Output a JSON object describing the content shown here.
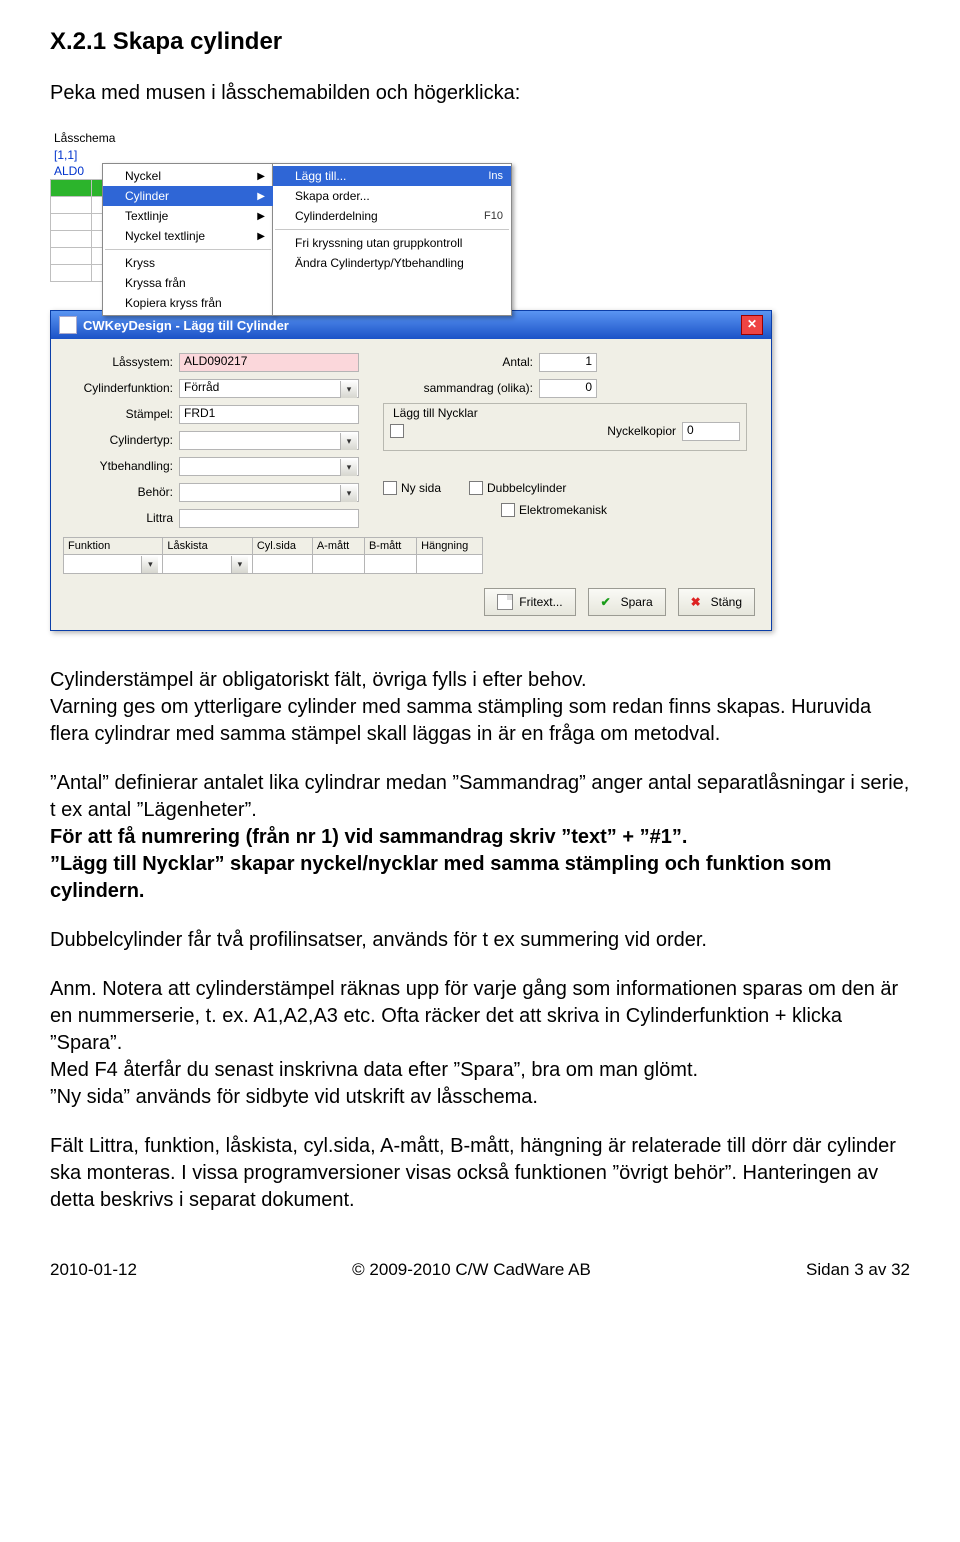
{
  "heading": "X.2.1 Skapa cylinder",
  "intro": "Peka med musen i låsschemabilden och högerklicka:",
  "scr1": {
    "title": "Låsschema",
    "coord": "[1,1]",
    "code": "ALD0",
    "menu1": {
      "items": [
        "Nyckel",
        "Cylinder",
        "Textlinje",
        "Nyckel textlinje"
      ],
      "items2": [
        "Kryss",
        "Kryssa från",
        "Kopiera kryss från"
      ]
    },
    "menu2": {
      "rows": [
        {
          "label": "Lägg till...",
          "short": "Ins",
          "sel": true
        },
        {
          "label": "Skapa order...",
          "short": ""
        },
        {
          "label": "Cylinderdelning",
          "short": "F10"
        }
      ],
      "rows2": [
        {
          "label": "Fri kryssning utan gruppkontroll"
        },
        {
          "label": "Ändra Cylindertyp/Ytbehandling"
        }
      ]
    }
  },
  "dialog": {
    "title": "CWKeyDesign - Lägg till Cylinder",
    "labels": {
      "lassystem": "Låssystem:",
      "cylfunk": "Cylinderfunktion:",
      "stampel": "Stämpel:",
      "cyltyp": "Cylindertyp:",
      "ytbeh": "Ytbehandling:",
      "behor": "Behör:",
      "littra": "Littra",
      "antal": "Antal:",
      "samman": "sammandrag (olika):",
      "grp": "Lägg till Nycklar",
      "kopior": "Nyckelkopior",
      "nysida": "Ny sida",
      "dubbel": "Dubbelcylinder",
      "elektro": "Elektromekanisk"
    },
    "values": {
      "lassystem": "ALD090217",
      "cylfunk": "Förråd",
      "stampel": "FRD1",
      "antal": "1",
      "samman": "0",
      "kopior": "0"
    },
    "cols": [
      "Funktion",
      "Låskista",
      "Cyl.sida",
      "A-mått",
      "B-mått",
      "Hängning"
    ],
    "buttons": {
      "fritext": "Fritext...",
      "spara": "Spara",
      "stang": "Stäng"
    }
  },
  "body": {
    "p1": "Cylinderstämpel är obligatoriskt fält, övriga fylls i efter behov.",
    "p2": "Varning ges om ytterligare cylinder med samma stämpling som redan finns skapas. Huruvida flera cylindrar med samma stämpel skall läggas in är en fråga om metodval.",
    "p3": "”Antal” definierar antalet lika cylindrar medan ”Sammandrag” anger antal separatlåsningar i serie, t ex antal ”Lägenheter”.",
    "p3b": "För att få numrering (från nr 1) vid sammandrag skriv ”text” + ”#1”.",
    "p3c": "”Lägg till Nycklar” skapar nyckel/nycklar med samma stämpling och funktion som cylindern.",
    "p4": "Dubbelcylinder får två profilinsatser, används för t ex summering vid order.",
    "p5a": "Anm. Notera att cylinderstämpel räknas upp för varje gång som informationen sparas om den är en nummerserie, t. ex. A1,A2,A3 etc. Ofta räcker det att skriva in Cylinderfunktion + klicka ”Spara”.",
    "p5b": "Med F4 återfår du senast inskrivna data efter ”Spara”, bra om man glömt.",
    "p5c": "”Ny sida” används för sidbyte vid utskrift av låsschema.",
    "p6": "Fält Littra, funktion, låskista, cyl.sida, A-mått, B-mått, hängning är relaterade till dörr där cylinder ska monteras. I vissa programversioner  visas också funktionen ”övrigt behör”. Hanteringen av detta beskrivs i separat dokument."
  },
  "footer": {
    "left": "2010-01-12",
    "center": "© 2009-2010 C/W CadWare AB",
    "right": "Sidan 3 av 32"
  }
}
